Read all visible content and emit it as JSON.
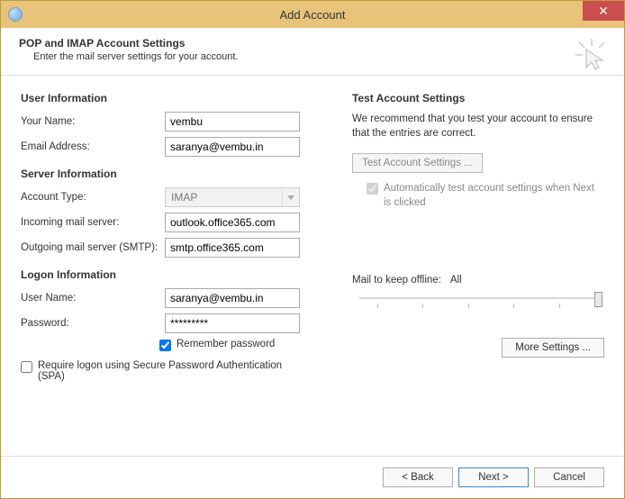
{
  "window": {
    "title": "Add Account",
    "close_glyph": "✕"
  },
  "header": {
    "title": "POP and IMAP Account Settings",
    "subtitle": "Enter the mail server settings for your account."
  },
  "sections": {
    "user_info": "User Information",
    "server_info": "Server Information",
    "logon_info": "Logon Information",
    "test_settings": "Test Account Settings"
  },
  "labels": {
    "your_name": "Your Name:",
    "email": "Email Address:",
    "account_type": "Account Type:",
    "incoming": "Incoming mail server:",
    "outgoing": "Outgoing mail server (SMTP):",
    "user_name": "User Name:",
    "password": "Password:",
    "remember_pw": "Remember password",
    "require_spa": "Require logon using Secure Password Authentication (SPA)",
    "test_desc": "We recommend that you test your account to ensure that the entries are correct.",
    "auto_test": "Automatically test account settings when Next is clicked",
    "mail_offline": "Mail to keep offline:",
    "mail_offline_value": "All"
  },
  "values": {
    "your_name": "vembu",
    "email": "saranya@vembu.in",
    "account_type": "IMAP",
    "incoming": "outlook.office365.com",
    "outgoing": "smtp.office365.com",
    "user_name": "saranya@vembu.in",
    "password": "*********"
  },
  "buttons": {
    "test": "Test Account Settings ...",
    "more": "More Settings ...",
    "back": "< Back",
    "next": "Next >",
    "cancel": "Cancel"
  },
  "checks": {
    "remember_pw": true,
    "auto_test": true,
    "require_spa": false
  }
}
